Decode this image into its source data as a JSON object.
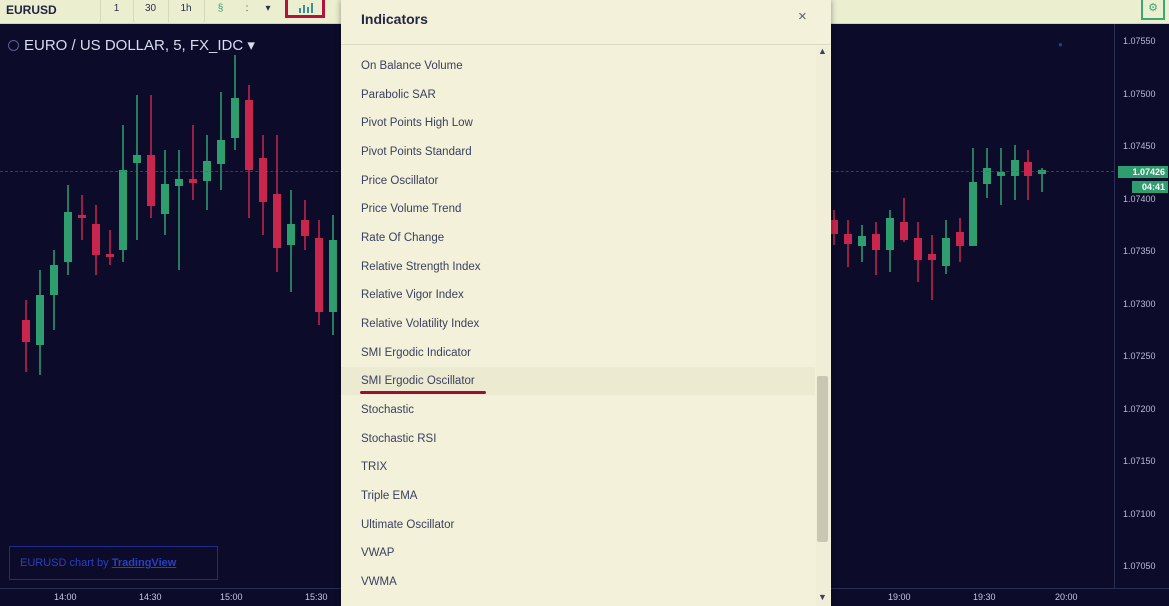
{
  "toolbar": {
    "symbol": "EURUSD",
    "intervals": [
      "1",
      "30",
      "1h"
    ],
    "extra_labels": [
      "§",
      ":",
      "▾"
    ],
    "indicators_icon": "indicators-icon",
    "right_icon": "settings-icon"
  },
  "chart": {
    "title": "EURO / US DOLLAR, 5, FX_IDC",
    "title_caret": "▾",
    "watermark": {
      "prefix": "EURUSD chart by",
      "brand": "TradingView"
    },
    "price_ticks": [
      "1.07550",
      "1.07500",
      "1.07450",
      "1.07400",
      "1.07350",
      "1.07300",
      "1.07250",
      "1.07200",
      "1.07150",
      "1.07100",
      "1.07050"
    ],
    "last_price": "1.07426",
    "countdown": "04:41",
    "time_ticks": [
      "14:00",
      "14:30",
      "15:00",
      "15:30",
      "19:00",
      "19:30",
      "20:00"
    ],
    "colors": {
      "up": "#2f9e6e",
      "down": "#c8264c",
      "background": "#0c0c2a",
      "toolbar": "#eceed0"
    }
  },
  "dialog": {
    "title": "Indicators",
    "close_icon": "×",
    "items": [
      "On Balance Volume",
      "Parabolic SAR",
      "Pivot Points High Low",
      "Pivot Points Standard",
      "Price Oscillator",
      "Price Volume Trend",
      "Rate Of Change",
      "Relative Strength Index",
      "Relative Vigor Index",
      "Relative Volatility Index",
      "SMI Ergodic Indicator",
      "SMI Ergodic Oscillator",
      "Stochastic",
      "Stochastic RSI",
      "TRIX",
      "Triple EMA",
      "Ultimate Oscillator",
      "VWAP",
      "VWMA"
    ],
    "highlighted_item": "SMI Ergodic Oscillator"
  }
}
